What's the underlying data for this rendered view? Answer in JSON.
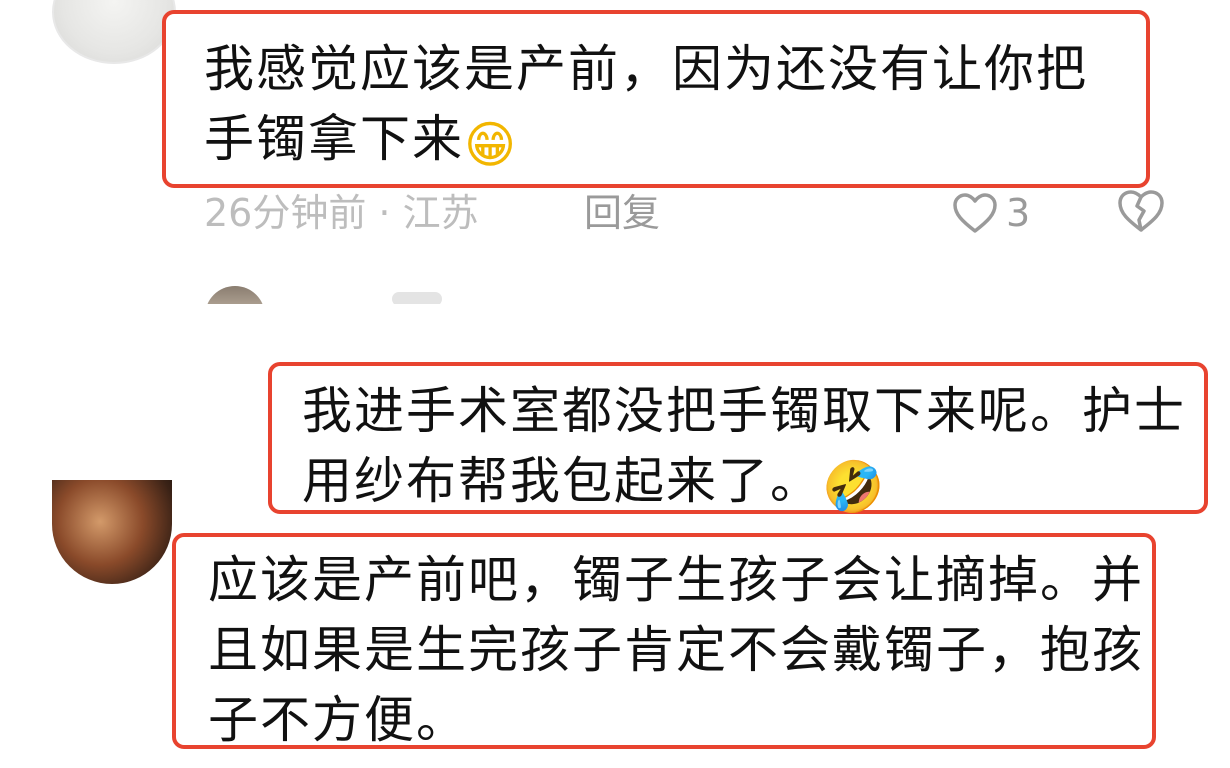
{
  "comment1": {
    "text": "我感觉应该是产前，因为还没有让你把手镯拿下来",
    "emoji": "😁",
    "time_location": "26分钟前 · 江苏",
    "reply_label": "回复",
    "like_count": "3"
  },
  "comment2": {
    "text": "我进手术室都没把手镯取下来呢。护士用纱布帮我包起来了。",
    "emoji": "🤣"
  },
  "comment3": {
    "text": "应该是产前吧，镯子生孩子会让摘掉。并且如果是生完孩子肯定不会戴镯子，抱孩子不方便。"
  },
  "icons": {
    "like": "heart-outline-icon",
    "dislike": "broken-heart-icon"
  },
  "colors": {
    "highlight_border": "#e8432f",
    "meta_text": "#bdbdbd",
    "action_text": "#9a9a9a"
  }
}
